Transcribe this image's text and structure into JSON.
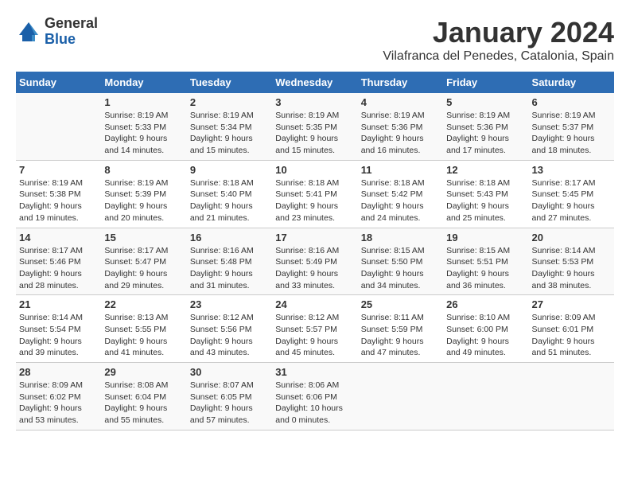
{
  "header": {
    "logo": {
      "general": "General",
      "blue": "Blue"
    },
    "title": "January 2024",
    "location": "Vilafranca del Penedes, Catalonia, Spain"
  },
  "weekdays": [
    "Sunday",
    "Monday",
    "Tuesday",
    "Wednesday",
    "Thursday",
    "Friday",
    "Saturday"
  ],
  "weeks": [
    [
      {
        "day": "",
        "info": ""
      },
      {
        "day": "1",
        "info": "Sunrise: 8:19 AM\nSunset: 5:33 PM\nDaylight: 9 hours\nand 14 minutes."
      },
      {
        "day": "2",
        "info": "Sunrise: 8:19 AM\nSunset: 5:34 PM\nDaylight: 9 hours\nand 15 minutes."
      },
      {
        "day": "3",
        "info": "Sunrise: 8:19 AM\nSunset: 5:35 PM\nDaylight: 9 hours\nand 15 minutes."
      },
      {
        "day": "4",
        "info": "Sunrise: 8:19 AM\nSunset: 5:36 PM\nDaylight: 9 hours\nand 16 minutes."
      },
      {
        "day": "5",
        "info": "Sunrise: 8:19 AM\nSunset: 5:36 PM\nDaylight: 9 hours\nand 17 minutes."
      },
      {
        "day": "6",
        "info": "Sunrise: 8:19 AM\nSunset: 5:37 PM\nDaylight: 9 hours\nand 18 minutes."
      }
    ],
    [
      {
        "day": "7",
        "info": "Sunrise: 8:19 AM\nSunset: 5:38 PM\nDaylight: 9 hours\nand 19 minutes."
      },
      {
        "day": "8",
        "info": "Sunrise: 8:19 AM\nSunset: 5:39 PM\nDaylight: 9 hours\nand 20 minutes."
      },
      {
        "day": "9",
        "info": "Sunrise: 8:18 AM\nSunset: 5:40 PM\nDaylight: 9 hours\nand 21 minutes."
      },
      {
        "day": "10",
        "info": "Sunrise: 8:18 AM\nSunset: 5:41 PM\nDaylight: 9 hours\nand 23 minutes."
      },
      {
        "day": "11",
        "info": "Sunrise: 8:18 AM\nSunset: 5:42 PM\nDaylight: 9 hours\nand 24 minutes."
      },
      {
        "day": "12",
        "info": "Sunrise: 8:18 AM\nSunset: 5:43 PM\nDaylight: 9 hours\nand 25 minutes."
      },
      {
        "day": "13",
        "info": "Sunrise: 8:17 AM\nSunset: 5:45 PM\nDaylight: 9 hours\nand 27 minutes."
      }
    ],
    [
      {
        "day": "14",
        "info": "Sunrise: 8:17 AM\nSunset: 5:46 PM\nDaylight: 9 hours\nand 28 minutes."
      },
      {
        "day": "15",
        "info": "Sunrise: 8:17 AM\nSunset: 5:47 PM\nDaylight: 9 hours\nand 29 minutes."
      },
      {
        "day": "16",
        "info": "Sunrise: 8:16 AM\nSunset: 5:48 PM\nDaylight: 9 hours\nand 31 minutes."
      },
      {
        "day": "17",
        "info": "Sunrise: 8:16 AM\nSunset: 5:49 PM\nDaylight: 9 hours\nand 33 minutes."
      },
      {
        "day": "18",
        "info": "Sunrise: 8:15 AM\nSunset: 5:50 PM\nDaylight: 9 hours\nand 34 minutes."
      },
      {
        "day": "19",
        "info": "Sunrise: 8:15 AM\nSunset: 5:51 PM\nDaylight: 9 hours\nand 36 minutes."
      },
      {
        "day": "20",
        "info": "Sunrise: 8:14 AM\nSunset: 5:53 PM\nDaylight: 9 hours\nand 38 minutes."
      }
    ],
    [
      {
        "day": "21",
        "info": "Sunrise: 8:14 AM\nSunset: 5:54 PM\nDaylight: 9 hours\nand 39 minutes."
      },
      {
        "day": "22",
        "info": "Sunrise: 8:13 AM\nSunset: 5:55 PM\nDaylight: 9 hours\nand 41 minutes."
      },
      {
        "day": "23",
        "info": "Sunrise: 8:12 AM\nSunset: 5:56 PM\nDaylight: 9 hours\nand 43 minutes."
      },
      {
        "day": "24",
        "info": "Sunrise: 8:12 AM\nSunset: 5:57 PM\nDaylight: 9 hours\nand 45 minutes."
      },
      {
        "day": "25",
        "info": "Sunrise: 8:11 AM\nSunset: 5:59 PM\nDaylight: 9 hours\nand 47 minutes."
      },
      {
        "day": "26",
        "info": "Sunrise: 8:10 AM\nSunset: 6:00 PM\nDaylight: 9 hours\nand 49 minutes."
      },
      {
        "day": "27",
        "info": "Sunrise: 8:09 AM\nSunset: 6:01 PM\nDaylight: 9 hours\nand 51 minutes."
      }
    ],
    [
      {
        "day": "28",
        "info": "Sunrise: 8:09 AM\nSunset: 6:02 PM\nDaylight: 9 hours\nand 53 minutes."
      },
      {
        "day": "29",
        "info": "Sunrise: 8:08 AM\nSunset: 6:04 PM\nDaylight: 9 hours\nand 55 minutes."
      },
      {
        "day": "30",
        "info": "Sunrise: 8:07 AM\nSunset: 6:05 PM\nDaylight: 9 hours\nand 57 minutes."
      },
      {
        "day": "31",
        "info": "Sunrise: 8:06 AM\nSunset: 6:06 PM\nDaylight: 10 hours\nand 0 minutes."
      },
      {
        "day": "",
        "info": ""
      },
      {
        "day": "",
        "info": ""
      },
      {
        "day": "",
        "info": ""
      }
    ]
  ]
}
